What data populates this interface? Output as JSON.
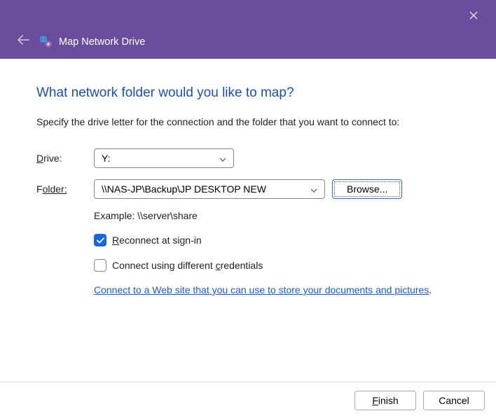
{
  "titlebar": {
    "title": "Map Network Drive"
  },
  "heading": "What network folder would you like to map?",
  "subtext": "Specify the drive letter for the connection and the folder that you want to connect to:",
  "labels": {
    "drive_pre": "D",
    "drive_post": "rive:",
    "folder_pre": "F",
    "folder_post": "older:"
  },
  "form": {
    "drive_value": "Y:",
    "folder_value": "\\\\NAS-JP\\Backup\\JP DESKTOP NEW",
    "browse_pre": "B",
    "browse_post": "rowse...",
    "example": "Example: \\\\server\\share"
  },
  "checks": {
    "reconnect_pre": "R",
    "reconnect_post": "econnect at sign-in",
    "creds_pre": "Connect using different ",
    "creds_ul": "c",
    "creds_post": "redentials"
  },
  "link": {
    "text": "Connect to a Web site that you can use to store your documents and pictures",
    "period": "."
  },
  "footer": {
    "finish_pre": "F",
    "finish_post": "inish",
    "cancel": "Cancel"
  }
}
